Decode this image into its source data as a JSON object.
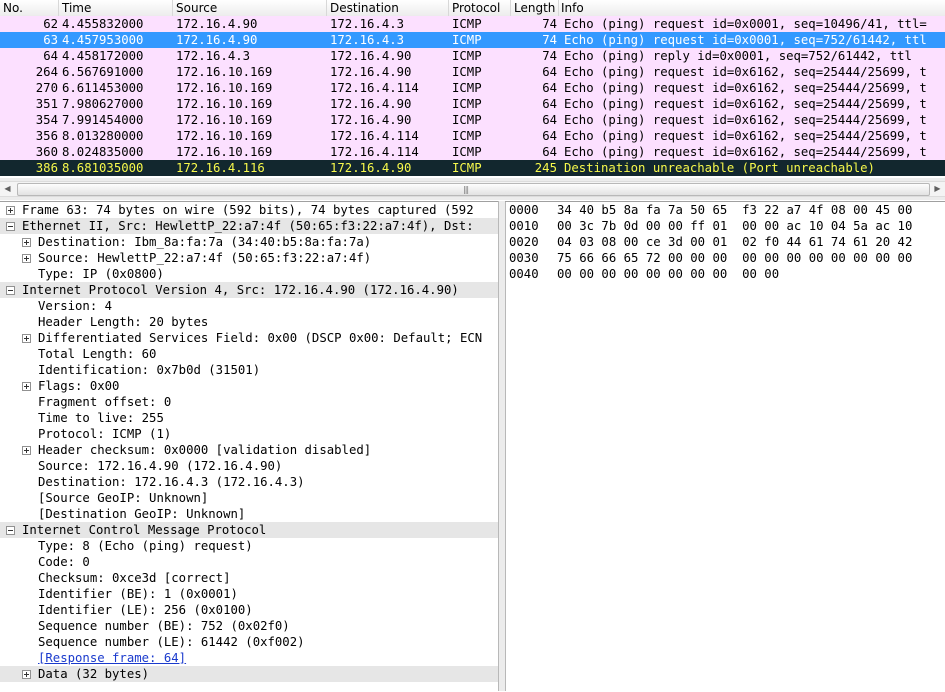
{
  "columns": [
    "No.",
    "Time",
    "Source",
    "Destination",
    "Protocol",
    "Length",
    "Info"
  ],
  "packets": [
    {
      "no": "62",
      "time": "4.455832000",
      "src": "172.16.4.90",
      "dst": "172.16.4.3",
      "proto": "ICMP",
      "len": "74",
      "info": "Echo (ping) request  id=0x0001, seq=10496/41, ttl=",
      "bg": "#fce0ff",
      "fg": "#000000"
    },
    {
      "no": "63",
      "time": "4.457953000",
      "src": "172.16.4.90",
      "dst": "172.16.4.3",
      "proto": "ICMP",
      "len": "74",
      "info": "Echo (ping) request  id=0x0001, seq=752/61442, ttl",
      "bg": "#3399ff",
      "fg": "#ffffff"
    },
    {
      "no": "64",
      "time": "4.458172000",
      "src": "172.16.4.3",
      "dst": "172.16.4.90",
      "proto": "ICMP",
      "len": "74",
      "info": "Echo (ping) reply    id=0x0001, seq=752/61442, ttl",
      "bg": "#fce0ff",
      "fg": "#000000"
    },
    {
      "no": "264",
      "time": "6.567691000",
      "src": "172.16.10.169",
      "dst": "172.16.4.90",
      "proto": "ICMP",
      "len": "64",
      "info": "Echo (ping) request  id=0x6162, seq=25444/25699, t",
      "bg": "#fce0ff",
      "fg": "#000000"
    },
    {
      "no": "270",
      "time": "6.611453000",
      "src": "172.16.10.169",
      "dst": "172.16.4.114",
      "proto": "ICMP",
      "len": "64",
      "info": "Echo (ping) request  id=0x6162, seq=25444/25699, t",
      "bg": "#fce0ff",
      "fg": "#000000"
    },
    {
      "no": "351",
      "time": "7.980627000",
      "src": "172.16.10.169",
      "dst": "172.16.4.90",
      "proto": "ICMP",
      "len": "64",
      "info": "Echo (ping) request  id=0x6162, seq=25444/25699, t",
      "bg": "#fce0ff",
      "fg": "#000000"
    },
    {
      "no": "354",
      "time": "7.991454000",
      "src": "172.16.10.169",
      "dst": "172.16.4.90",
      "proto": "ICMP",
      "len": "64",
      "info": "Echo (ping) request  id=0x6162, seq=25444/25699, t",
      "bg": "#fce0ff",
      "fg": "#000000"
    },
    {
      "no": "356",
      "time": "8.013280000",
      "src": "172.16.10.169",
      "dst": "172.16.4.114",
      "proto": "ICMP",
      "len": "64",
      "info": "Echo (ping) request  id=0x6162, seq=25444/25699, t",
      "bg": "#fce0ff",
      "fg": "#000000"
    },
    {
      "no": "360",
      "time": "8.024835000",
      "src": "172.16.10.169",
      "dst": "172.16.4.114",
      "proto": "ICMP",
      "len": "64",
      "info": "Echo (ping) request  id=0x6162, seq=25444/25699, t",
      "bg": "#fce0ff",
      "fg": "#000000"
    },
    {
      "no": "386",
      "time": "8.681035000",
      "src": "172.16.4.116",
      "dst": "172.16.4.90",
      "proto": "ICMP",
      "len": "245",
      "info": "Destination unreachable (Port unreachable)",
      "bg": "#12272e",
      "fg": "#f7f94c"
    }
  ],
  "scroll_grip": "|||",
  "tree": [
    {
      "indent": 0,
      "exp": "plus",
      "text": "Frame 63: 74 bytes on wire (592 bits), 74 bytes captured (592",
      "sel": false
    },
    {
      "indent": 0,
      "exp": "minus",
      "text": "Ethernet II, Src: HewlettP_22:a7:4f (50:65:f3:22:a7:4f), Dst:",
      "sel": true
    },
    {
      "indent": 1,
      "exp": "plus",
      "text": "Destination: Ibm_8a:fa:7a (34:40:b5:8a:fa:7a)",
      "sel": false
    },
    {
      "indent": 1,
      "exp": "plus",
      "text": "Source: HewlettP_22:a7:4f (50:65:f3:22:a7:4f)",
      "sel": false
    },
    {
      "indent": 1,
      "exp": "none",
      "text": "Type: IP (0x0800)",
      "sel": false
    },
    {
      "indent": 0,
      "exp": "minus",
      "text": "Internet Protocol Version 4, Src: 172.16.4.90 (172.16.4.90)",
      "sel": true
    },
    {
      "indent": 1,
      "exp": "none",
      "text": "Version: 4",
      "sel": false
    },
    {
      "indent": 1,
      "exp": "none",
      "text": "Header Length: 20 bytes",
      "sel": false
    },
    {
      "indent": 1,
      "exp": "plus",
      "text": "Differentiated Services Field: 0x00 (DSCP 0x00: Default; ECN",
      "sel": false
    },
    {
      "indent": 1,
      "exp": "none",
      "text": "Total Length: 60",
      "sel": false
    },
    {
      "indent": 1,
      "exp": "none",
      "text": "Identification: 0x7b0d (31501)",
      "sel": false
    },
    {
      "indent": 1,
      "exp": "plus",
      "text": "Flags: 0x00",
      "sel": false
    },
    {
      "indent": 1,
      "exp": "none",
      "text": "Fragment offset: 0",
      "sel": false
    },
    {
      "indent": 1,
      "exp": "none",
      "text": "Time to live: 255",
      "sel": false
    },
    {
      "indent": 1,
      "exp": "none",
      "text": "Protocol: ICMP (1)",
      "sel": false
    },
    {
      "indent": 1,
      "exp": "plus",
      "text": "Header checksum: 0x0000 [validation disabled]",
      "sel": false
    },
    {
      "indent": 1,
      "exp": "none",
      "text": "Source: 172.16.4.90 (172.16.4.90)",
      "sel": false
    },
    {
      "indent": 1,
      "exp": "none",
      "text": "Destination: 172.16.4.3 (172.16.4.3)",
      "sel": false
    },
    {
      "indent": 1,
      "exp": "none",
      "text": "[Source GeoIP: Unknown]",
      "sel": false
    },
    {
      "indent": 1,
      "exp": "none",
      "text": "[Destination GeoIP: Unknown]",
      "sel": false
    },
    {
      "indent": 0,
      "exp": "minus",
      "text": "Internet Control Message Protocol",
      "sel": true
    },
    {
      "indent": 1,
      "exp": "none",
      "text": "Type: 8 (Echo (ping) request)",
      "sel": false
    },
    {
      "indent": 1,
      "exp": "none",
      "text": "Code: 0",
      "sel": false
    },
    {
      "indent": 1,
      "exp": "none",
      "text": "Checksum: 0xce3d [correct]",
      "sel": false
    },
    {
      "indent": 1,
      "exp": "none",
      "text": "Identifier (BE): 1 (0x0001)",
      "sel": false
    },
    {
      "indent": 1,
      "exp": "none",
      "text": "Identifier (LE): 256 (0x0100)",
      "sel": false
    },
    {
      "indent": 1,
      "exp": "none",
      "text": "Sequence number (BE): 752 (0x02f0)",
      "sel": false
    },
    {
      "indent": 1,
      "exp": "none",
      "text": "Sequence number (LE): 61442 (0xf002)",
      "sel": false
    },
    {
      "indent": 1,
      "exp": "none",
      "text": "[Response frame: 64]",
      "sel": false,
      "link": true
    },
    {
      "indent": 1,
      "exp": "plus",
      "text": "Data (32 bytes)",
      "sel": true
    }
  ],
  "hex": [
    {
      "off": "0000",
      "bytes": "34 40 b5 8a fa 7a 50 65  f3 22 a7 4f 08 00 45 00"
    },
    {
      "off": "0010",
      "bytes": "00 3c 7b 0d 00 00 ff 01  00 00 ac 10 04 5a ac 10"
    },
    {
      "off": "0020",
      "bytes": "04 03 08 00 ce 3d 00 01  02 f0 44 61 74 61 20 42"
    },
    {
      "off": "0030",
      "bytes": "75 66 66 65 72 00 00 00  00 00 00 00 00 00 00 00"
    },
    {
      "off": "0040",
      "bytes": "00 00 00 00 00 00 00 00  00 00"
    }
  ]
}
